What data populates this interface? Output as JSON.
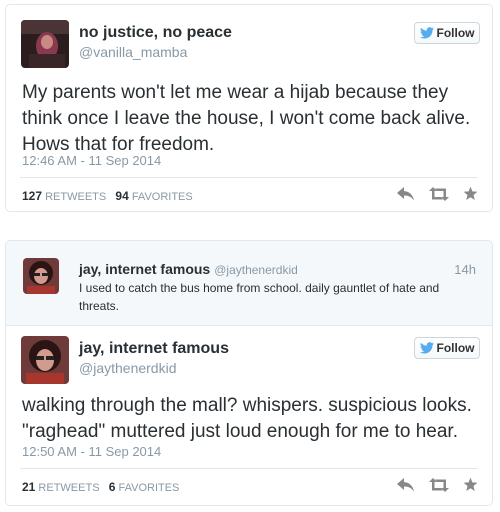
{
  "tweet1": {
    "display_name": "no justice, no peace",
    "handle": "@vanilla_mamba",
    "follow_label": "Follow",
    "text": "My parents won't let me wear a hijab because they think once I leave the house, I won't come back alive. Hows that for freedom.",
    "timestamp": "12:46 AM - 11 Sep 2014",
    "retweets_count": "127",
    "retweets_label": "RETWEETS",
    "favorites_count": "94",
    "favorites_label": "FAVORITES"
  },
  "tweet2": {
    "parent": {
      "display_name": "jay, internet famous",
      "handle": "@jaythenerdkid",
      "time": "14h",
      "text": "I used to catch the bus home from school. daily gauntlet of hate and threats."
    },
    "display_name": "jay, internet famous",
    "handle": "@jaythenerdkid",
    "follow_label": "Follow",
    "text": "walking through the mall? whispers. suspicious looks. \"raghead\" muttered just loud enough for me to hear.",
    "timestamp": "12:50 AM - 11 Sep 2014",
    "retweets_count": "21",
    "retweets_label": "RETWEETS",
    "favorites_count": "6",
    "favorites_label": "FAVORITES"
  },
  "icons": {
    "follow": "twitter-bird-icon",
    "reply": "reply-icon",
    "retweet": "retweet-icon",
    "favorite": "star-icon"
  },
  "colors": {
    "twitter_blue": "#55acee",
    "muted_text": "#8899a6",
    "border": "#e1e8ed",
    "action_gray": "#888888"
  }
}
